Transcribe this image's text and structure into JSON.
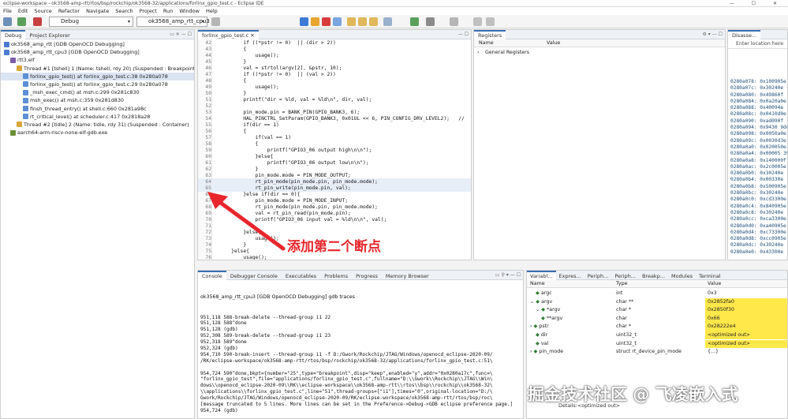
{
  "window": {
    "title": "eclipse-workspace - ok3568-amp-rtt/rtos/bsp/rockchip/ok3568-32/applications/forlinx_gpio_test.c - Eclipse IDE"
  },
  "menu": [
    "File",
    "Edit",
    "Source",
    "Refactor",
    "Navigate",
    "Search",
    "Project",
    "Run",
    "Window",
    "Help"
  ],
  "toolbar": {
    "mode_select": "Debug",
    "config_select": "ok3568_amp_rtt_cpu3"
  },
  "debug": {
    "tabs": [
      "Debug",
      "Project Explorer"
    ],
    "tree": [
      {
        "label": "ok3568_amp_rtt [GDB OpenOCD Debugging]",
        "indent": 0,
        "icon": "launch-icon",
        "color": "#4a7bd0"
      },
      {
        "label": "ok3568_amp_rtt_cpu3 [GDB OpenOCD Debugging]",
        "indent": 0,
        "icon": "launch-icon",
        "color": "#4a7bd0"
      },
      {
        "label": "rtt3.elf",
        "indent": 1,
        "icon": "elf-icon",
        "color": "#7a5da8"
      },
      {
        "label": "Thread #1 [tshell] 1 (Name: tshell, rdy 20) (Suspended : Breakpoint)",
        "indent": 2,
        "icon": "thread-icon",
        "color": "#d9a43a"
      },
      {
        "label": "forlinx_gpio_test() at forlinx_gpio_test.c:38 0x280a078",
        "indent": 3,
        "icon": "frame-icon",
        "color": "#5b8fd6",
        "sel": true
      },
      {
        "label": "forlinx_gpio_test() at forlinx_gpio_test.c:29 0x280a078",
        "indent": 3,
        "icon": "frame-icon",
        "color": "#5b8fd6"
      },
      {
        "label": "_msh_exec_cmd() at msh.c:299 0x281c830",
        "indent": 3,
        "icon": "frame-icon",
        "color": "#5b8fd6"
      },
      {
        "label": "msh_exec() at msh.c:359 0x281d830",
        "indent": 3,
        "icon": "frame-icon",
        "color": "#5b8fd6"
      },
      {
        "label": "finsh_thread_entry() at shell.c:660 0x281a98c",
        "indent": 3,
        "icon": "frame-icon",
        "color": "#5b8fd6"
      },
      {
        "label": "rt_critical_level() at scheduler.c:417 0x2818a28",
        "indent": 3,
        "icon": "frame-icon",
        "color": "#5b8fd6"
      },
      {
        "label": "Thread #2 [tidle] 2 (Name: tidle, rdy 31) (Suspended : Container)",
        "indent": 2,
        "icon": "thread-icon",
        "color": "#d9a43a"
      },
      {
        "label": "aarch64-arm-riscv-none-elf-gdb.exe",
        "indent": 1,
        "icon": "gdb-icon",
        "color": "#6d8f3a"
      }
    ]
  },
  "editor": {
    "tab": "forlinx_gpio_test.c",
    "lines": [
      {
        "n": "42",
        "t": "        if ((*pstr != 0)  || (dir > 2))"
      },
      {
        "n": "43",
        "t": "        {"
      },
      {
        "n": "44",
        "t": "            usage();"
      },
      {
        "n": "45",
        "t": "        }"
      },
      {
        "n": "46",
        "t": "        val = strtol(argv[2], &pstr, 10);"
      },
      {
        "n": "47",
        "t": "        if ((*pstr != 0)  || (val > 2))"
      },
      {
        "n": "48",
        "t": "        {"
      },
      {
        "n": "49",
        "t": "            usage();"
      },
      {
        "n": "50",
        "t": "        }"
      },
      {
        "n": "51",
        "t": "        printf(\"dir = %ld, val = %ld\\n\", dir, val);"
      },
      {
        "n": "52",
        "t": ""
      },
      {
        "n": "53",
        "t": "        pin_mode.pin = BANK_PIN(GPIO_BANK3, 6);"
      },
      {
        "n": "54",
        "t": "        HAL_PINCTRL_SetParam(GPIO_BANK3, 0x01UL << 6, PIN_CONFIG_DRV_LEVEL2);   //"
      },
      {
        "n": "55",
        "t": "        if(dir == 1)"
      },
      {
        "n": "56",
        "t": "        {"
      },
      {
        "n": "57",
        "t": "            if(val == 1)"
      },
      {
        "n": "58",
        "t": "            {"
      },
      {
        "n": "59",
        "t": "                printf(\"GPIO3_06 output high\\n\\n\");"
      },
      {
        "n": "60",
        "t": "            }else{"
      },
      {
        "n": "61",
        "t": "                printf(\"GPIO3_06 output low\\n\\n\");"
      },
      {
        "n": "62",
        "t": "            }"
      },
      {
        "n": "63",
        "t": "            pin_mode.mode = PIN_MODE_OUTPUT;"
      },
      {
        "n": "64",
        "t": "            rt_pin_mode(pin_mode.pin, pin_mode.mode);"
      },
      {
        "n": "65",
        "t": "            rt_pin_write(pin_mode.pin, val);"
      },
      {
        "n": "66",
        "t": "        }else if(dir == 0){"
      },
      {
        "n": "67",
        "t": "            pin_mode.mode = PIN_MODE_INPUT;"
      },
      {
        "n": "68",
        "t": "            rt_pin_mode(pin_mode.pin, pin_mode.mode);"
      },
      {
        "n": "69",
        "t": "            val = rt_pin_read(pin_mode.pin);"
      },
      {
        "n": "70",
        "t": "            printf(\"GPIO3_06 input val = %ld\\n\\n\", val);"
      },
      {
        "n": "71",
        "t": ""
      },
      {
        "n": "72",
        "t": "        }else{"
      },
      {
        "n": "73",
        "t": "            usage();"
      },
      {
        "n": "74",
        "t": "        }"
      },
      {
        "n": "75",
        "t": "    }else{"
      },
      {
        "n": "76",
        "t": "        usage();"
      }
    ]
  },
  "registers": {
    "tabs": [
      "Registers"
    ],
    "col_name": "Name",
    "col_value": "Value",
    "group": "General Registers"
  },
  "disasm": {
    "tab": "Disasse...",
    "placeholder": "Enter location here",
    "rows": [
      "0280a078: 0x100905e",
      "0280a07c: 0x30240e",
      "0280a080: 0x49860f",
      "0280a084: 0x0a20a0e",
      "0280a088: 0x40094e",
      "0280a08c: 0x0410d0e",
      "0280a090: 0xad090f",
      "0280a094: 0x9430 9de",
      "0280a098: 0x0050a0e",
      "0280a09c: 0x0030d3e",
      "0280a0a0: 0x020050e",
      "0280a0a4: 0x00005 39",
      "0280a0a8: 0x140000f",
      "0280a0ac: 0x2c0005e",
      "0280a0b0: 0x30240e",
      "0280a0b4: 0x00330e",
      "0280a0b8: 0x500905e",
      "0280a0bc: 0x30240e",
      "0280a0c0: 0xcd3300e",
      "0280a0c4: 0x840905e",
      "0280a0c8: 0x30240e",
      "0280a0cc: 0xca3300e",
      "0280a0d0: 0xa40905e",
      "0280a0d4: 0xc73300e",
      "0280a0d8: 0xcc0905e",
      "0280a0dc: 0x30240e",
      "0280a0e0: 0x43300e"
    ]
  },
  "console": {
    "tabs": [
      "Console",
      "Debugger Console",
      "Executables",
      "Problems",
      "Progress",
      "Memory Browser"
    ],
    "header": "ok3568_amp_rtt_cpu3 [GDB OpenOCD Debugging] gdb traces",
    "lines": [
      "951,118 588-break-delete --thread-group i1 22",
      "951,128 588^done",
      "951,128 (gdb)",
      "952,308 589-break-delete --thread-group i1 23",
      "952,318 589^done",
      "952,324 (gdb)",
      "954,710 590-break-insert --thread-group i1 -f D:/Gwork/Rockchip/JTAG/Windows/openocd_eclipse-2020-09/",
      "/RK/eclipse-workspace/ok3568-amp-rtt/rtos/bsp/rockchip/ok3568-32/applications/forlinx_gpio_test.c:51\\",
      "",
      "954,724 590^done,bkpt={number=\"25\",type=\"breakpoint\",disp=\"keep\",enabled=\"y\",addr=\"0x0280a17c\",func=\\",
      "\"forlinx_gpio_test\",file=\"applications/forlinx_gpio_test.c\",fullname=\"D:\\\\Gwork\\\\Rockchip\\\\JTAG\\\\Win\\",
      "dows\\\\openocd_eclipse-2020-09\\\\RK\\\\eclipse-workspace\\\\ok3568-amp-rtt\\\\rtos\\\\bsp\\\\rockchip\\\\ok3568-32\\",
      "\\\\applications\\\\forlinx_gpio_test.c\",line=\"51\",thread-groups=[\"i1\"],times=\"0\",original-location=\"D:/\\",
      "Gwork/Rockchip/JTAG/Windows/openocd_eclipse-2020-09/RK/eclipse-workspace/ok3568-amp-rtt/rtos/bsp/roc\\",
      "[message truncated to 5 lines. More lines can be set in the Preference->Debug->GDB eclipse preference page.]",
      "954,724 (gdb)"
    ]
  },
  "variables": {
    "tabs": [
      "Variabl...",
      "Expres...",
      "Periph...",
      "Periph...",
      "Breakp...",
      "Modules",
      "Terminal"
    ],
    "columns": [
      "Name",
      "Type",
      "Value"
    ],
    "rows": [
      {
        "name": "argc",
        "type": "int",
        "value": "0x3",
        "indent": 1,
        "exp": "",
        "yellow": false
      },
      {
        "name": "argv",
        "type": "char **",
        "value": "0x2852fa0",
        "indent": 0,
        "exp": "⌄",
        "yellow": true
      },
      {
        "name": "*argv",
        "type": "char *",
        "value": "0x2850f30",
        "indent": 1,
        "exp": "⌄",
        "yellow": true
      },
      {
        "name": "**argv",
        "type": "char",
        "value": "0x66",
        "indent": 2,
        "exp": "",
        "yellow": true
      },
      {
        "name": "pstr",
        "type": "char *",
        "value": "0x28222e4",
        "indent": 0,
        "exp": "›",
        "yellow": true
      },
      {
        "name": "dir",
        "type": "uint32_t",
        "value": "<optimized out>",
        "indent": 1,
        "exp": "",
        "yellow": true
      },
      {
        "name": "val",
        "type": "uint32_t",
        "value": "<optimized out>",
        "indent": 1,
        "exp": "",
        "yellow": true
      },
      {
        "name": "pin_mode",
        "type": "struct rt_device_pin_mode",
        "value": "{...}",
        "indent": 0,
        "exp": "›",
        "yellow": false
      }
    ],
    "details": "Details:<optimized out>"
  },
  "annotation": "添加第二个断点",
  "watermark": "掘金技术社区 @ 飞凌嵌入式",
  "colors": {
    "accent": "#3a6fb0",
    "annotation": "#e8262c",
    "highlight": "#ffe84a"
  }
}
